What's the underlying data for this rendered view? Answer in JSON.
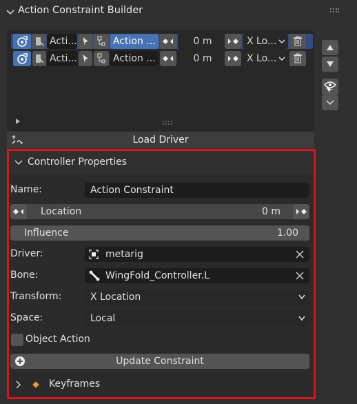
{
  "panel": {
    "title": "Action Constraint Builder"
  },
  "list": {
    "rows": [
      {
        "name": "Acti...",
        "target": "Action ...",
        "frame": "0 m",
        "transform": "X Lo...",
        "selected": true
      },
      {
        "name": "Acti...",
        "target": "Action ...",
        "frame": "0 m",
        "transform": "X Lo...",
        "selected": false
      }
    ]
  },
  "load_driver": {
    "label": "Load Driver"
  },
  "controller": {
    "title": "Controller Properties",
    "name_label": "Name:",
    "name_value": "Action Constraint",
    "location_label": "Location",
    "location_value": "0 m",
    "influence_label": "Influence",
    "influence_value": "1.00",
    "driver_label": "Driver:",
    "driver_value": "metarig",
    "bone_label": "Bone:",
    "bone_value": "WingFold_Controller.L",
    "transform_label": "Transform:",
    "transform_value": "X Location",
    "space_label": "Space:",
    "space_value": "Local",
    "object_action_label": "Object Action",
    "update_label": "Update Constraint",
    "keyframes_label": "Keyframes"
  },
  "colors": {
    "accent": "#4772b3",
    "highlight_border": "#d8141c",
    "keyframe": "#e8a33a"
  }
}
